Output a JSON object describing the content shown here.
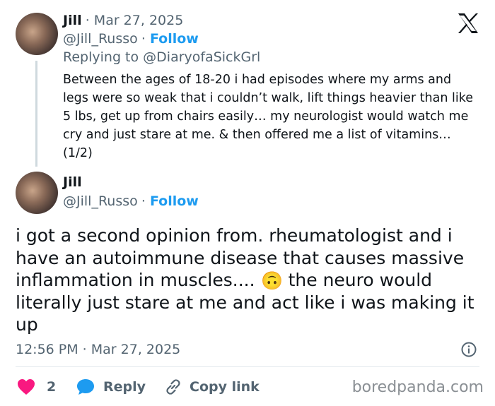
{
  "reply_tweet": {
    "name": "Jill",
    "date": "Mar 27, 2025",
    "handle": "@Jill_Russo",
    "follow": "Follow",
    "replying_to": "Replying to @DiaryofaSickGrl",
    "text": "Between the ages of 18-20 i had episodes where my arms and legs were so weak that i couldn’t walk, lift things heavier than like 5 lbs, get up from chairs easily… my neurologist would watch me cry and just stare at me. & then offered me a list of vitamins… (1/2)"
  },
  "main_tweet": {
    "name": "Jill",
    "handle": "@Jill_Russo",
    "follow": "Follow",
    "text_before": "i got a second opinion from. rheumatologist and i have an autoimmune disease that causes massive inflammation in muscles.... ",
    "emoji": "🙂",
    "text_after": " the neuro would literally just stare at me and act like i was making it up",
    "timestamp": "12:56 PM · Mar 27, 2025"
  },
  "actions": {
    "likes": "2",
    "reply": "Reply",
    "copy_link": "Copy link"
  },
  "watermark": "boredpanda.com",
  "colors": {
    "accent": "#1d9bf0",
    "heart": "#f91880",
    "muted": "#536471"
  }
}
